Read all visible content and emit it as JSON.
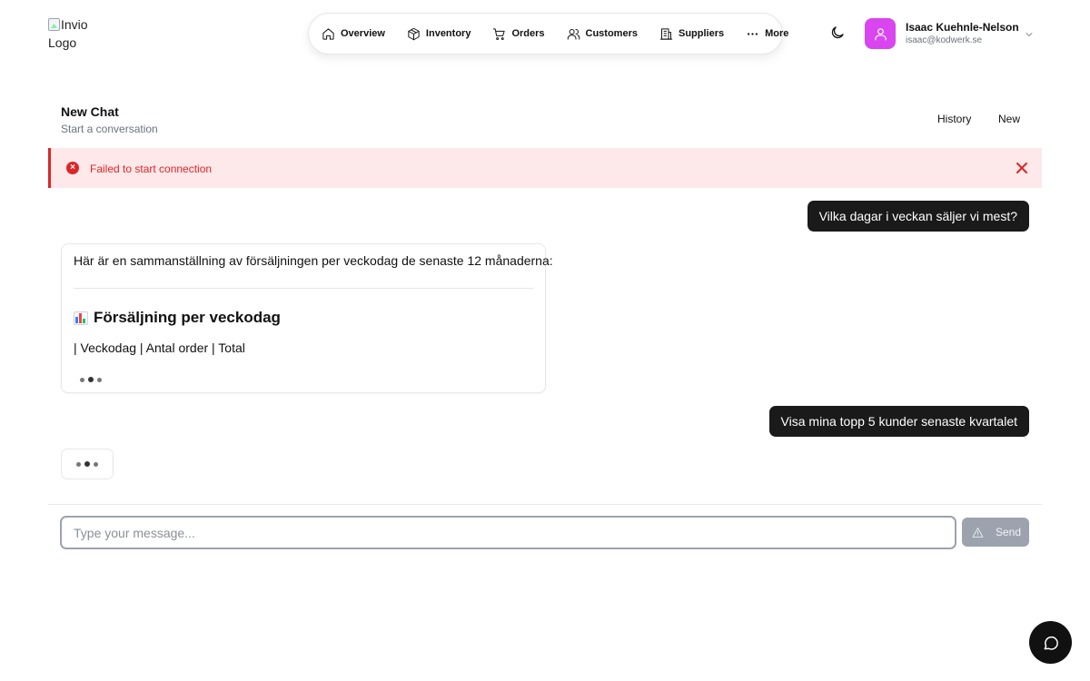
{
  "header": {
    "logo_alt": "Invio Logo",
    "nav": [
      {
        "label": "Overview",
        "icon": "home-icon"
      },
      {
        "label": "Inventory",
        "icon": "box-icon"
      },
      {
        "label": "Orders",
        "icon": "cart-icon"
      },
      {
        "label": "Customers",
        "icon": "users-icon"
      },
      {
        "label": "Suppliers",
        "icon": "building-icon"
      },
      {
        "label": "More",
        "icon": "more-dots-icon"
      }
    ],
    "theme_icon": "moon-icon",
    "user": {
      "name": "Isaac Kuehnle-Nelson",
      "email": "isaac@kodwerk.se",
      "avatar_color": "#d946ef"
    }
  },
  "chat": {
    "title": "New Chat",
    "subtitle": "Start a conversation",
    "history_label": "History",
    "new_label": "New"
  },
  "error": {
    "message": "Failed to start connection",
    "color": "#dc2626"
  },
  "messages": {
    "user_1": "Vilka dagar i veckan säljer vi mest?",
    "assistant_intro": "Här är en sammanställning av försäljningen per veckodag de senaste 12 månaderna:",
    "assistant_heading": "Försäljning per veckodag",
    "assistant_table_row": "| Veckodag | Antal order | Total",
    "user_2": "Visa mina topp 5 kunder senaste kvartalet"
  },
  "composer": {
    "placeholder": "Type your message...",
    "send_label": "Send"
  }
}
